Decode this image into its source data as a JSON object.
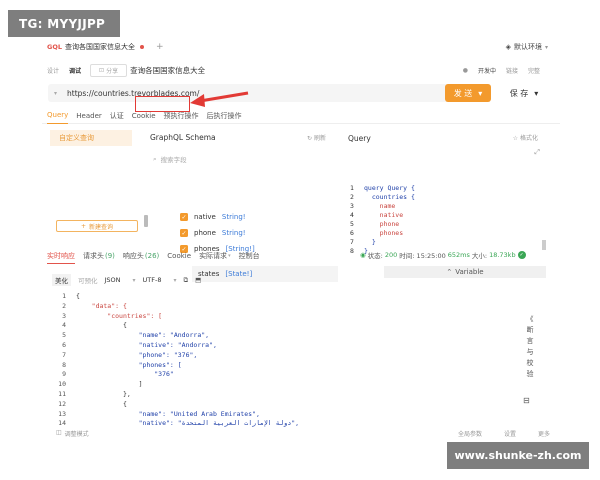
{
  "watermarks": {
    "top_left": "TG: MYYJJPP",
    "bottom_right": "www.shunke-zh.com"
  },
  "tabbar": {
    "badge": "GQL",
    "title": "查询各国国家信息大全",
    "plus": "+",
    "env_label": "默认环境"
  },
  "crumbs": {
    "design": "设计",
    "debug": "调试",
    "share": "分享",
    "title": "查询各国国家信息大全",
    "right": {
      "dev": "开发中",
      "member": "",
      "link": "链接",
      "more": "完整"
    }
  },
  "request": {
    "url": "https://countries.trevorblades.com/",
    "send": "发 送",
    "save": "保 存"
  },
  "request_tabs": [
    "Query",
    "Header",
    "认证",
    "Cookie",
    "预执行操作",
    "后执行操作"
  ],
  "left_panel": {
    "custom_query": "自定义查询",
    "new_query": "新建查询"
  },
  "schema": {
    "title": "GraphQL Schema",
    "refresh": "刷新",
    "search_placeholder": "搜索字段",
    "fields": [
      {
        "name": "native",
        "type": "String!"
      },
      {
        "name": "phone",
        "type": "String!"
      },
      {
        "name": "phones",
        "type": "[String!]"
      }
    ],
    "states": {
      "name": "states",
      "type": "[State!]"
    }
  },
  "query_panel": {
    "title": "Query",
    "format": "格式化",
    "lines": [
      "query Query {",
      "  countries {",
      "    name",
      "    native",
      "    phone",
      "    phones",
      "  }",
      "}"
    ],
    "variable": "Variable"
  },
  "response_tabs": [
    {
      "label": "实时响应",
      "count": ""
    },
    {
      "label": "请求头",
      "count": "(9)"
    },
    {
      "label": "响应头",
      "count": "(26)"
    },
    {
      "label": "Cookie",
      "count": ""
    },
    {
      "label": "实际请求",
      "count": ""
    },
    {
      "label": "控制台",
      "count": ""
    }
  ],
  "status": {
    "label": "状态:",
    "code": "200",
    "text": "时间: 15:25:00",
    "time": "652ms",
    "size_label": "大小:",
    "size": "18.73kb"
  },
  "format_bar": {
    "beautify": "美化",
    "raw": "可预化",
    "type": "JSON",
    "encoding": "UTF-8"
  },
  "response_lines": [
    {
      "n": "1",
      "t": "{"
    },
    {
      "n": "2",
      "t": "    \"data\": {"
    },
    {
      "n": "3",
      "t": "        \"countries\": ["
    },
    {
      "n": "4",
      "t": "            {"
    },
    {
      "n": "5",
      "t": "                \"name\": \"Andorra\","
    },
    {
      "n": "6",
      "t": "                \"native\": \"Andorra\","
    },
    {
      "n": "7",
      "t": "                \"phone\": \"376\","
    },
    {
      "n": "8",
      "t": "                \"phones\": ["
    },
    {
      "n": "9",
      "t": "                    \"376\""
    },
    {
      "n": "10",
      "t": "                ]"
    },
    {
      "n": "11",
      "t": "            },"
    },
    {
      "n": "12",
      "t": "            {"
    },
    {
      "n": "13",
      "t": "                \"name\": \"United Arab Emirates\","
    },
    {
      "n": "14",
      "t": "                \"native\": \"دولة الإمارات العربية المتحدة\","
    }
  ],
  "side_tab": {
    "chars": [
      "《",
      "断",
      "言",
      "与",
      "校",
      "验"
    ]
  },
  "footer": {
    "left": "调整模式",
    "params": "全局参数",
    "settings": "设置",
    "more": "更多"
  },
  "colors": {
    "accent": "#f39a2d",
    "badge": "#e2544b",
    "annotation": "#e23a35",
    "success": "#3aa655",
    "type": "#3c7bd8"
  }
}
